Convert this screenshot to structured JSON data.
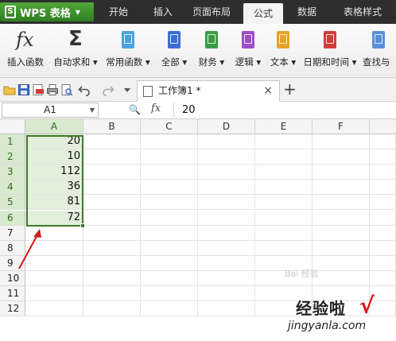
{
  "app": {
    "name": "WPS 表格"
  },
  "menu_tabs": [
    {
      "label": "开始"
    },
    {
      "label": "插入"
    },
    {
      "label": "页面布局"
    },
    {
      "label": "公式"
    },
    {
      "label": "数据"
    },
    {
      "label": "表格样式"
    }
  ],
  "ribbon": {
    "items": [
      {
        "label": "插入函数",
        "icon": "fx-icon"
      },
      {
        "label": "自动求和 ▾",
        "icon": "sigma-icon"
      },
      {
        "label": "常用函数 ▾",
        "icon": "book-icon"
      },
      {
        "label": "全部 ▾",
        "icon": "book-icon"
      },
      {
        "label": "财务 ▾",
        "icon": "book-icon"
      },
      {
        "label": "逻辑 ▾",
        "icon": "book-icon"
      },
      {
        "label": "文本 ▾",
        "icon": "book-icon"
      },
      {
        "label": "日期和时间 ▾",
        "icon": "book-icon"
      },
      {
        "label": "查找与",
        "icon": "book-icon"
      }
    ],
    "colors": [
      "#4aa3df",
      "#3a6fd1",
      "#3b9b45",
      "#9b4fc8",
      "#e7a22a",
      "#d63a3a",
      "#5b8fd8"
    ]
  },
  "doc": {
    "tab_title": "工作簿1 *",
    "close": "×",
    "new": "+"
  },
  "formula_bar": {
    "name_box": "A1",
    "fx": "fx",
    "value": "20"
  },
  "sheet": {
    "columns": [
      "A",
      "B",
      "C",
      "D",
      "E",
      "F"
    ],
    "rows": [
      "1",
      "2",
      "3",
      "4",
      "5",
      "6",
      "7",
      "8",
      "9",
      "10",
      "11",
      "12"
    ],
    "column_a": [
      "20",
      "10",
      "112",
      "36",
      "81",
      "72"
    ]
  },
  "watermark": {
    "title": "经验啦",
    "url": "jingyanla.com",
    "check": "√",
    "baidu": "Bai 经验"
  },
  "colors": {
    "selection_border": "#3e7d2a",
    "selection_fill": "#e2efda",
    "arrow": "#d81818"
  }
}
